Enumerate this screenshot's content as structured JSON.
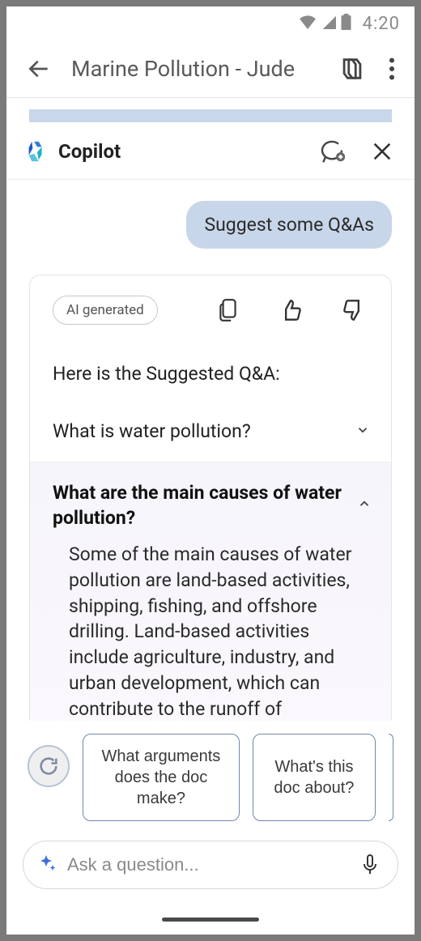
{
  "status": {
    "time": "4:20"
  },
  "header": {
    "title": "Marine Pollution - Jude"
  },
  "copilot": {
    "title": "Copilot"
  },
  "chat": {
    "user_message": "Suggest some Q&As",
    "ai_badge": "AI generated",
    "intro": "Here is the Suggested Q&A:",
    "qa": [
      {
        "question": "What is water pollution?",
        "expanded": false
      },
      {
        "question": "What are the main causes of water pollution?",
        "expanded": true,
        "answer": "Some of the main causes of water pollution are land-based activities, shipping, fishing, and offshore drilling. Land-based activities include agriculture, industry, and urban development, which can contribute to the runoff of chemicals and trash into waterways that ultimately flow"
      }
    ]
  },
  "suggestions": {
    "chip1": "What arguments does the doc make?",
    "chip2": "What's this doc about?"
  },
  "input": {
    "placeholder": "Ask a question..."
  }
}
